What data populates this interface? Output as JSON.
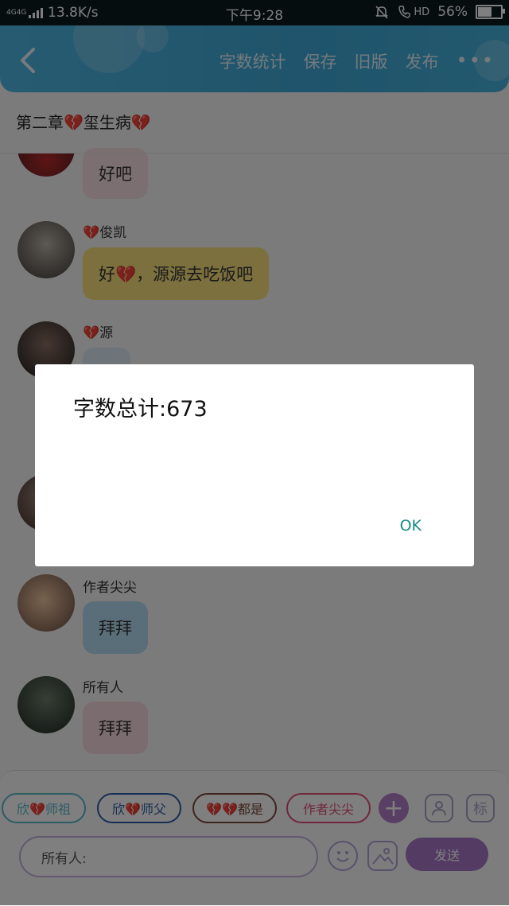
{
  "status_bar": {
    "network": "4G4G",
    "speed": "13.8K/s",
    "time": "下午9:28",
    "hd": "HD",
    "battery": "56%",
    "battery_level": 0.56
  },
  "header": {
    "actions": [
      "字数统计",
      "保存",
      "旧版",
      "发布"
    ],
    "more": "•••"
  },
  "chapter_title": "第二章💔玺生病💔",
  "messages": [
    {
      "name": "",
      "text": "好吧",
      "color": "#f6dfe3"
    },
    {
      "name": "💔俊凯",
      "text": "好💔，源源去吃饭吧",
      "color": "#f9e07e"
    },
    {
      "name": "💔源",
      "text": "",
      "color": "#dbe9f4"
    },
    {
      "name": "作者尖尖",
      "text": "拜拜",
      "color": "#b4dcf3"
    },
    {
      "name": "所有人",
      "text": "拜拜",
      "color": "#f6d8de"
    }
  ],
  "bottom_bar": {
    "chips": [
      "欣💔师祖",
      "欣💔师父",
      "💔💔都是",
      "作者尖尖"
    ],
    "chip_colors": [
      "#59b8c9",
      "#2b5ea8",
      "#7a4a3a",
      "#e04f78"
    ],
    "plus": "+",
    "label_icon": "标",
    "input_value": "所有人:",
    "send": "发送"
  },
  "dialog": {
    "message": "字数总计:673",
    "ok": "OK"
  }
}
